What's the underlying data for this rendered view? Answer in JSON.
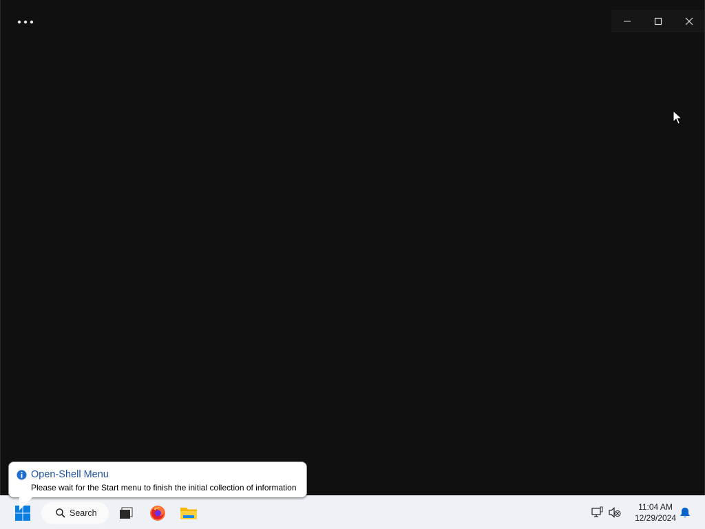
{
  "window": {
    "more_icon": "more-horizontal-icon",
    "controls": [
      "minimize-icon",
      "maximize-icon",
      "close-icon"
    ]
  },
  "toast": {
    "icon": "info-icon",
    "title": "Open-Shell Menu",
    "body": "Please wait for the Start menu to finish the initial collection of information"
  },
  "taskbar": {
    "start_icon": "windows-logo-icon",
    "search_label": "Search",
    "apps": [
      "task-view-icon",
      "firefox-icon",
      "file-explorer-icon"
    ],
    "tray_icons": [
      "network-icon",
      "sound-muted-icon"
    ],
    "clock": {
      "time": "11:04 AM",
      "date": "12/29/2024"
    },
    "notification_icon": "bell-icon"
  },
  "colors": {
    "window_bg": "#101010",
    "taskbar_bg": "#eef1f6",
    "accent": "#0078d4",
    "toast_title": "#1f4fa0"
  }
}
